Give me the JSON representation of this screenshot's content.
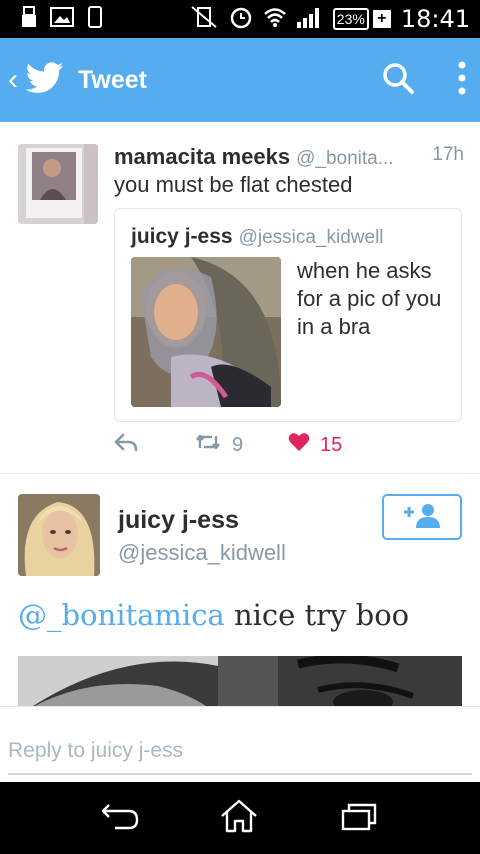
{
  "status_bar": {
    "battery": "23%",
    "time": "18:41"
  },
  "header": {
    "title": "Tweet"
  },
  "tweet": {
    "author_name": "mamacita meeks",
    "author_handle": "@_bonita...",
    "time": "17h",
    "text": "you must be flat chested",
    "quoted": {
      "author_name": "juicy j-ess",
      "author_handle": "@jessica_kidwell",
      "text": "when he asks for a pic of you in a bra"
    },
    "retweet_count": "9",
    "like_count": "15"
  },
  "reply_tweet": {
    "author_name": "juicy j-ess",
    "author_handle": "@jessica_kidwell",
    "mention": "@_bonitamica",
    "text": " nice try boo"
  },
  "reply_box": {
    "placeholder": "Reply to juicy j-ess"
  },
  "colors": {
    "brand": "#55acee",
    "like": "#e0245e",
    "muted": "#8899a6"
  }
}
